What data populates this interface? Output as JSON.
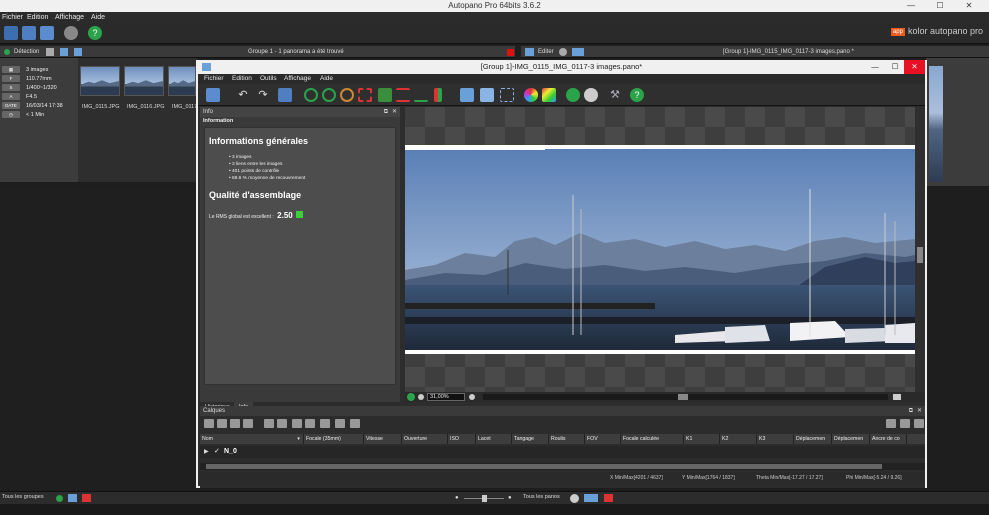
{
  "app": {
    "title": "Autopano Pro 64bits 3.6.2",
    "menu": [
      "Fichier",
      "Edition",
      "Affichage",
      "Aide"
    ],
    "brand": "kolor autopano pro",
    "brand_logo": "app"
  },
  "left_panel": {
    "header_left": "Détection",
    "header_center": "Groupe 1 - 1 panorama a été trouvé",
    "info": [
      {
        "tag": "",
        "value": "3 images"
      },
      {
        "tag": "F",
        "value": "110.77mm"
      },
      {
        "tag": "S",
        "value": "1/400~1/320"
      },
      {
        "tag": "A",
        "value": "F4.5"
      },
      {
        "tag": "DATE",
        "value": "16/03/14 17:38"
      },
      {
        "tag": "",
        "value": "< 1 Min"
      }
    ],
    "thumbnails": [
      "IMG_0115.JPG",
      "IMG_0116.JPG",
      "IMG_0117.JPG"
    ]
  },
  "right_panel": {
    "header_left": "Editer",
    "header_right": "[Group 1]-IMG_0115_IMG_0117-3 images.pano *"
  },
  "editor": {
    "title": "[Group 1]-IMG_0115_IMG_0117-3 images.pano*",
    "menu": [
      "Fichier",
      "Edition",
      "Outils",
      "Affichage",
      "Aide"
    ],
    "info_panel": {
      "header": "Info",
      "section": "Information",
      "general_title": "Informations générales",
      "bullets": [
        "3 images",
        "3 liens entre les images",
        "401 points de contrôle",
        "68.6 % moyenne de recouvrement"
      ],
      "quality_title": "Qualité d'assemblage",
      "rms_label": "Le RMS global est excellent :",
      "rms_value": "2.50",
      "tabs": [
        "Historique",
        "Info"
      ]
    },
    "zoom": "31,00%",
    "layers": {
      "header": "Calques",
      "columns": [
        "Nom",
        "Focale (35mm)",
        "Vitesse",
        "Ouverture",
        "ISO",
        "Lacet",
        "Tangage",
        "Roulis",
        "FOV",
        "Focale calculée",
        "K1",
        "K2",
        "K3",
        "Déplacemen",
        "Déplacemen",
        "Ancre de co"
      ],
      "row_name": "N_0",
      "row_check": "✓"
    },
    "status": {
      "x": "X Min/Max[4201 / 4637]",
      "y": "Y Min/Max[1764 / 1837]",
      "theta": "Theta Min/Max[-17.27 / 17.27]",
      "phi": "Phi Min/Max[-5.24 / 9.26]"
    }
  },
  "bottom_bar": {
    "left": "Tous les groupes",
    "right": "Tous les panos"
  },
  "colors": {
    "accent_orange": "#e85b1a",
    "close_red": "#d11",
    "panel_dark": "#2b2b2b",
    "rms_green": "#3ad13a"
  }
}
